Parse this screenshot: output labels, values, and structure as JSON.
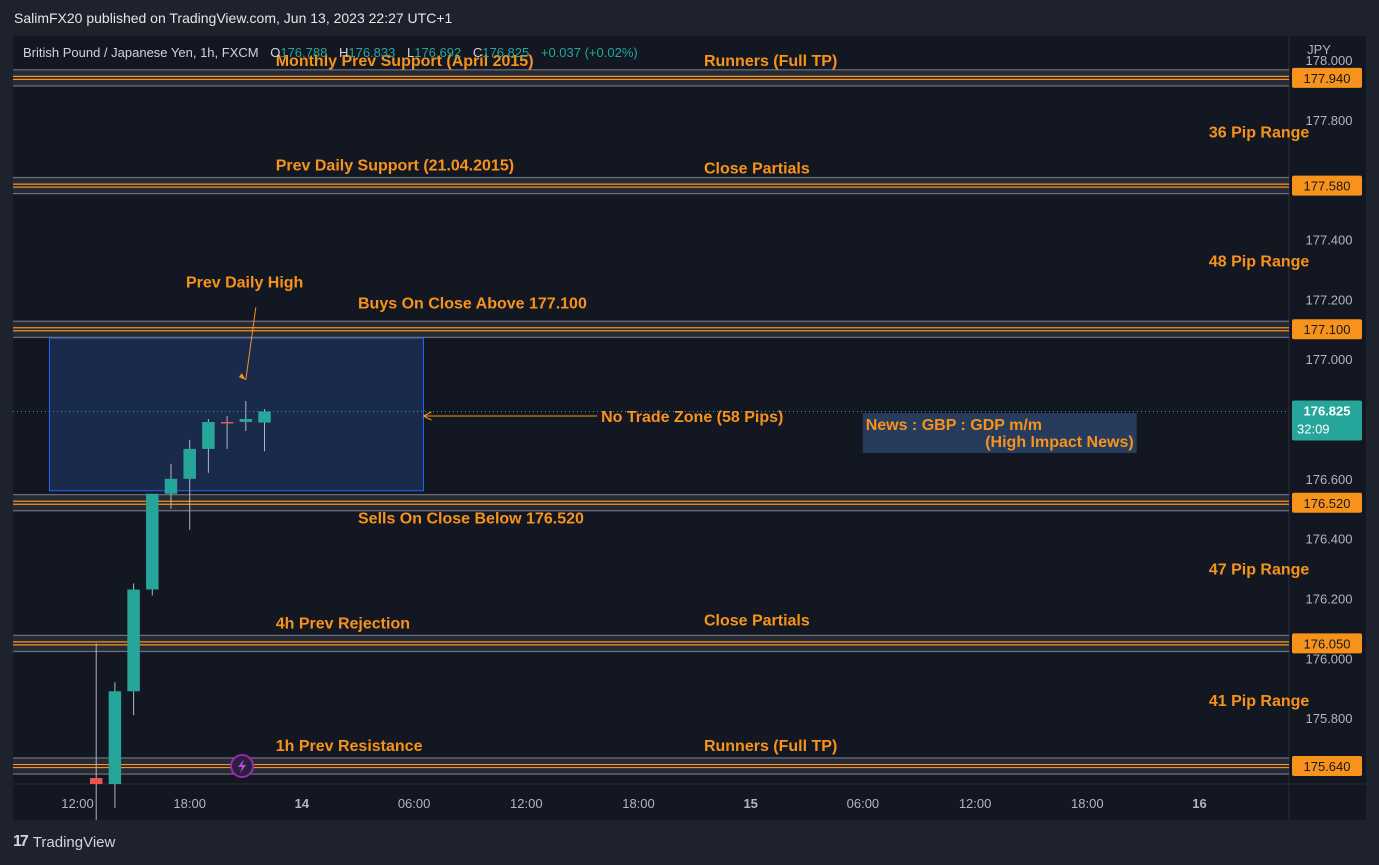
{
  "header": {
    "published": "SalimFX20 published on TradingView.com, Jun 13, 2023 22:27 UTC+1"
  },
  "legend": {
    "symbol": "British Pound / Japanese Yen, 1h, FXCM",
    "o_label": "O",
    "o_value": "176.788",
    "h_label": "H",
    "h_value": "176.833",
    "l_label": "L",
    "l_value": "176.692",
    "c_label": "C",
    "c_value": "176.825",
    "change": "+0.037 (+0.02%)"
  },
  "footer": {
    "brand": "TradingView",
    "brand_mark": "17"
  },
  "colors": {
    "background": "#131722",
    "page": "#1e222d",
    "up": "#26a69a",
    "down": "#ef5350",
    "level": "#f7931a",
    "annotation": "#f7931a",
    "zone_fill": "#1d3258",
    "zone_border": "#2962ff",
    "axis_text": "#b2b5be",
    "last_price_badge": "#26a69a",
    "news_fill": "#2a3f63"
  },
  "chart_data": {
    "type": "candlestick",
    "currency": "JPY",
    "ylim": [
      175.58,
      178.08
    ],
    "y_ticks": [
      "178.000",
      "177.800",
      "177.400",
      "177.200",
      "177.000",
      "176.600",
      "176.400",
      "176.200",
      "176.000",
      "175.800"
    ],
    "x_ticks": [
      {
        "label": "12:00",
        "day": 0,
        "hour": 12,
        "bold": false
      },
      {
        "label": "18:00",
        "day": 0,
        "hour": 18,
        "bold": false
      },
      {
        "label": "14",
        "day": 1,
        "hour": 0,
        "bold": true
      },
      {
        "label": "06:00",
        "day": 1,
        "hour": 6,
        "bold": false
      },
      {
        "label": "12:00",
        "day": 1,
        "hour": 12,
        "bold": false
      },
      {
        "label": "18:00",
        "day": 1,
        "hour": 18,
        "bold": false
      },
      {
        "label": "15",
        "day": 2,
        "hour": 0,
        "bold": true
      },
      {
        "label": "06:00",
        "day": 2,
        "hour": 6,
        "bold": false
      },
      {
        "label": "12:00",
        "day": 2,
        "hour": 12,
        "bold": false
      },
      {
        "label": "18:00",
        "day": 2,
        "hour": 18,
        "bold": false
      },
      {
        "label": "16",
        "day": 3,
        "hour": 0,
        "bold": true
      }
    ],
    "candles": [
      {
        "day": 0,
        "hour": 13,
        "o": 175.6,
        "h": 176.05,
        "l": 175.4,
        "c": 175.58
      },
      {
        "day": 0,
        "hour": 14,
        "o": 175.58,
        "h": 175.92,
        "l": 175.5,
        "c": 175.89
      },
      {
        "day": 0,
        "hour": 15,
        "o": 175.89,
        "h": 176.25,
        "l": 175.81,
        "c": 176.23
      },
      {
        "day": 0,
        "hour": 16,
        "o": 176.23,
        "h": 176.24,
        "l": 176.21,
        "c": 176.55
      },
      {
        "day": 0,
        "hour": 17,
        "o": 176.55,
        "h": 176.65,
        "l": 176.5,
        "c": 176.6
      },
      {
        "day": 0,
        "hour": 18,
        "o": 176.6,
        "h": 176.73,
        "l": 176.43,
        "c": 176.7
      },
      {
        "day": 0,
        "hour": 19,
        "o": 176.7,
        "h": 176.8,
        "l": 176.62,
        "c": 176.79
      },
      {
        "day": 0,
        "hour": 20,
        "o": 176.79,
        "h": 176.81,
        "l": 176.7,
        "c": 176.79
      },
      {
        "day": 0,
        "hour": 21,
        "o": 176.79,
        "h": 176.86,
        "l": 176.76,
        "c": 176.8
      },
      {
        "day": 0,
        "hour": 22,
        "o": 176.788,
        "h": 176.833,
        "l": 176.692,
        "c": 176.825
      }
    ],
    "levels": [
      {
        "price": 177.94,
        "label": "177.940"
      },
      {
        "price": 177.58,
        "label": "177.580"
      },
      {
        "price": 177.1,
        "label": "177.100"
      },
      {
        "price": 176.52,
        "label": "176.520"
      },
      {
        "price": 176.05,
        "label": "176.050"
      },
      {
        "price": 175.64,
        "label": "175.640"
      }
    ],
    "last_price": {
      "value": "176.825",
      "countdown": "32:09"
    },
    "no_trade_zone": {
      "from_day": 0,
      "from_hour": 10.5,
      "to_day": 1,
      "to_hour": 6.5,
      "top": 177.07,
      "bottom": 176.56
    },
    "annotations": [
      {
        "text": "Monthly Prev Support (April 2015)",
        "day": 0,
        "hour": 22.6,
        "price": 177.98
      },
      {
        "text": "Runners (Full TP)",
        "day": 1,
        "hour": 21.5,
        "price": 177.98
      },
      {
        "text": "36 Pip Range",
        "day": 3,
        "hour": 0.5,
        "price": 177.74
      },
      {
        "text": "Prev Daily Support (21.04.2015)",
        "day": 0,
        "hour": 22.6,
        "price": 177.63
      },
      {
        "text": "Close Partials",
        "day": 1,
        "hour": 21.5,
        "price": 177.62
      },
      {
        "text": "48 Pip Range",
        "day": 3,
        "hour": 0.5,
        "price": 177.31
      },
      {
        "text": "Prev Daily High",
        "day": 0,
        "hour": 17.8,
        "price": 177.24
      },
      {
        "text": "Buys On Close Above 177.100",
        "day": 1,
        "hour": 3.0,
        "price": 177.17
      },
      {
        "text": "No Trade Zone (58 Pips)",
        "day": 1,
        "hour": 16.0,
        "price": 176.79
      },
      {
        "text": "Sells On Close Below 176.520",
        "day": 1,
        "hour": 3.0,
        "price": 176.45
      },
      {
        "text": "47 Pip Range",
        "day": 3,
        "hour": 0.5,
        "price": 176.28
      },
      {
        "text": "4h Prev Rejection",
        "day": 0,
        "hour": 22.6,
        "price": 176.1
      },
      {
        "text": "Close Partials",
        "day": 1,
        "hour": 21.5,
        "price": 176.11
      },
      {
        "text": "41 Pip Range",
        "day": 3,
        "hour": 0.5,
        "price": 175.84
      },
      {
        "text": "1h Prev Resistance",
        "day": 0,
        "hour": 22.6,
        "price": 175.69
      },
      {
        "text": "Runners (Full TP)",
        "day": 1,
        "hour": 21.5,
        "price": 175.69
      }
    ],
    "news": {
      "line1": "News : GBP : GDP m/m",
      "line2": "(High Impact News)"
    }
  }
}
